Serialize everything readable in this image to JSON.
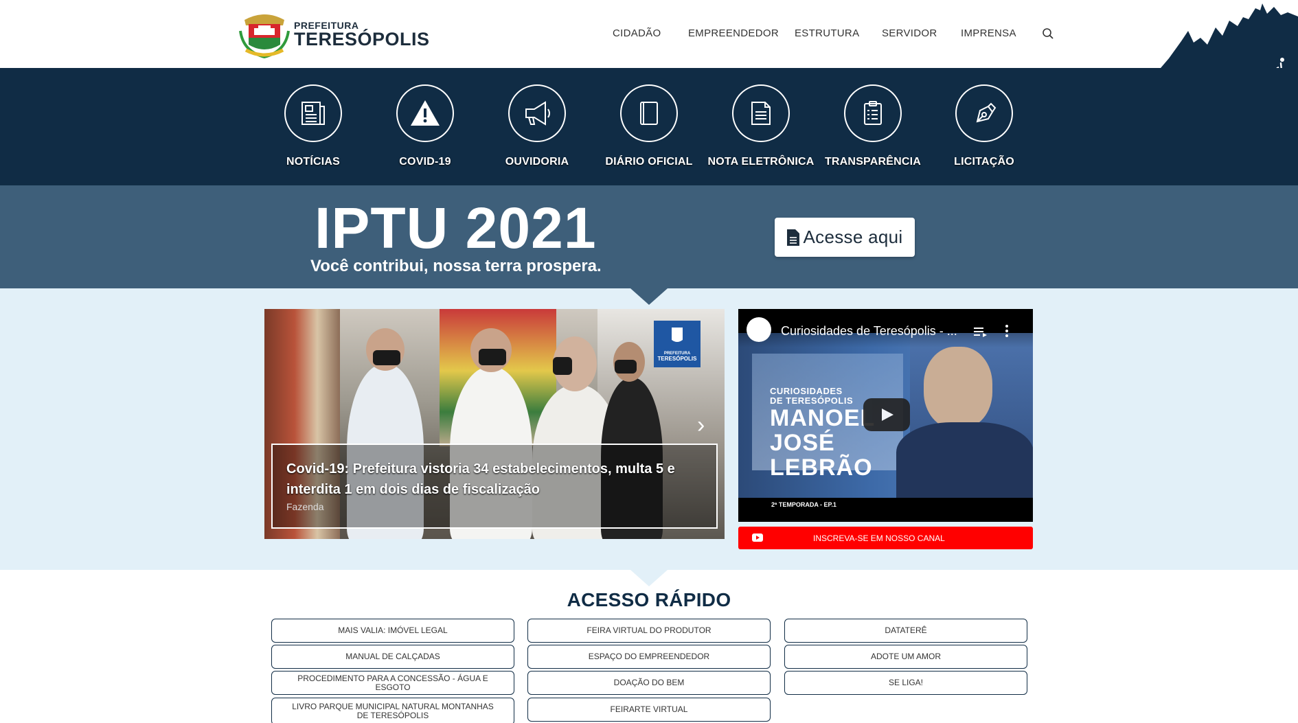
{
  "header": {
    "logo_small": "PREFEITURA",
    "logo_big": "TERESÓPOLIS",
    "nav": [
      "CIDADÃO",
      "EMPREENDEDOR",
      "ESTRUTURA",
      "SERVIDOR",
      "IMPRENSA"
    ]
  },
  "services": [
    "NOTÍCIAS",
    "COVID-19",
    "OUVIDORIA",
    "DIÁRIO OFICIAL",
    "NOTA ELETRÔNICA",
    "TRANSPARÊNCIA",
    "LICITAÇÃO"
  ],
  "iptu": {
    "title": "IPTU 2021",
    "subtitle": "Você contribui, nossa terra prospera.",
    "button": "Acesse aqui"
  },
  "news": {
    "title": "Covid-19: Prefeitura vistoria 34 estabelecimentos, multa 5 e interdita 1 em dois dias de fiscalização",
    "tag": "Fazenda",
    "badge_small": "PREFEITURA",
    "badge_big": "TERESÓPOLIS"
  },
  "video": {
    "title": "Curiosidades de Teresópolis - ...",
    "overlay_small1": "CURIOSIDADES",
    "overlay_small2": "DE TERESÓPOLIS",
    "overlay_line1": "MANOEL",
    "overlay_line2": "JOSÉ",
    "overlay_line3": "LEBRÃO",
    "overlay_ep": "2ª TEMPORADA - EP.1",
    "subscribe": "INSCREVA-SE EM NOSSO CANAL"
  },
  "quick_access": {
    "title": "ACESSO RÁPIDO",
    "col1": [
      "MAIS VALIA: IMÓVEL LEGAL",
      "MANUAL DE CALÇADAS",
      "PROCEDIMENTO PARA A CONCESSÃO - ÁGUA E ESGOTO",
      "LIVRO PARQUE MUNICIPAL NATURAL MONTANHAS DE TERESÓPOLIS"
    ],
    "col2": [
      "FEIRA VIRTUAL DO PRODUTOR",
      "ESPAÇO DO EMPREENDEDOR",
      "DOAÇÃO DO BEM",
      "FEIRARTE VIRTUAL"
    ],
    "col3": [
      "DATATERÊ",
      "ADOTE UM AMOR",
      "SE LIGA!"
    ]
  },
  "colors": {
    "navy": "#102c45",
    "banner": "#3e5f7a",
    "light_bg": "#e2f0f8",
    "youtube_red": "#ff0000"
  },
  "icons": [
    "newspaper-icon",
    "warning-icon",
    "megaphone-icon",
    "book-icon",
    "document-icon",
    "clipboard-icon",
    "pen-nib-icon",
    "search-icon",
    "accessibility-icon",
    "sign-language-icon",
    "play-icon",
    "youtube-icon",
    "file-icon"
  ]
}
